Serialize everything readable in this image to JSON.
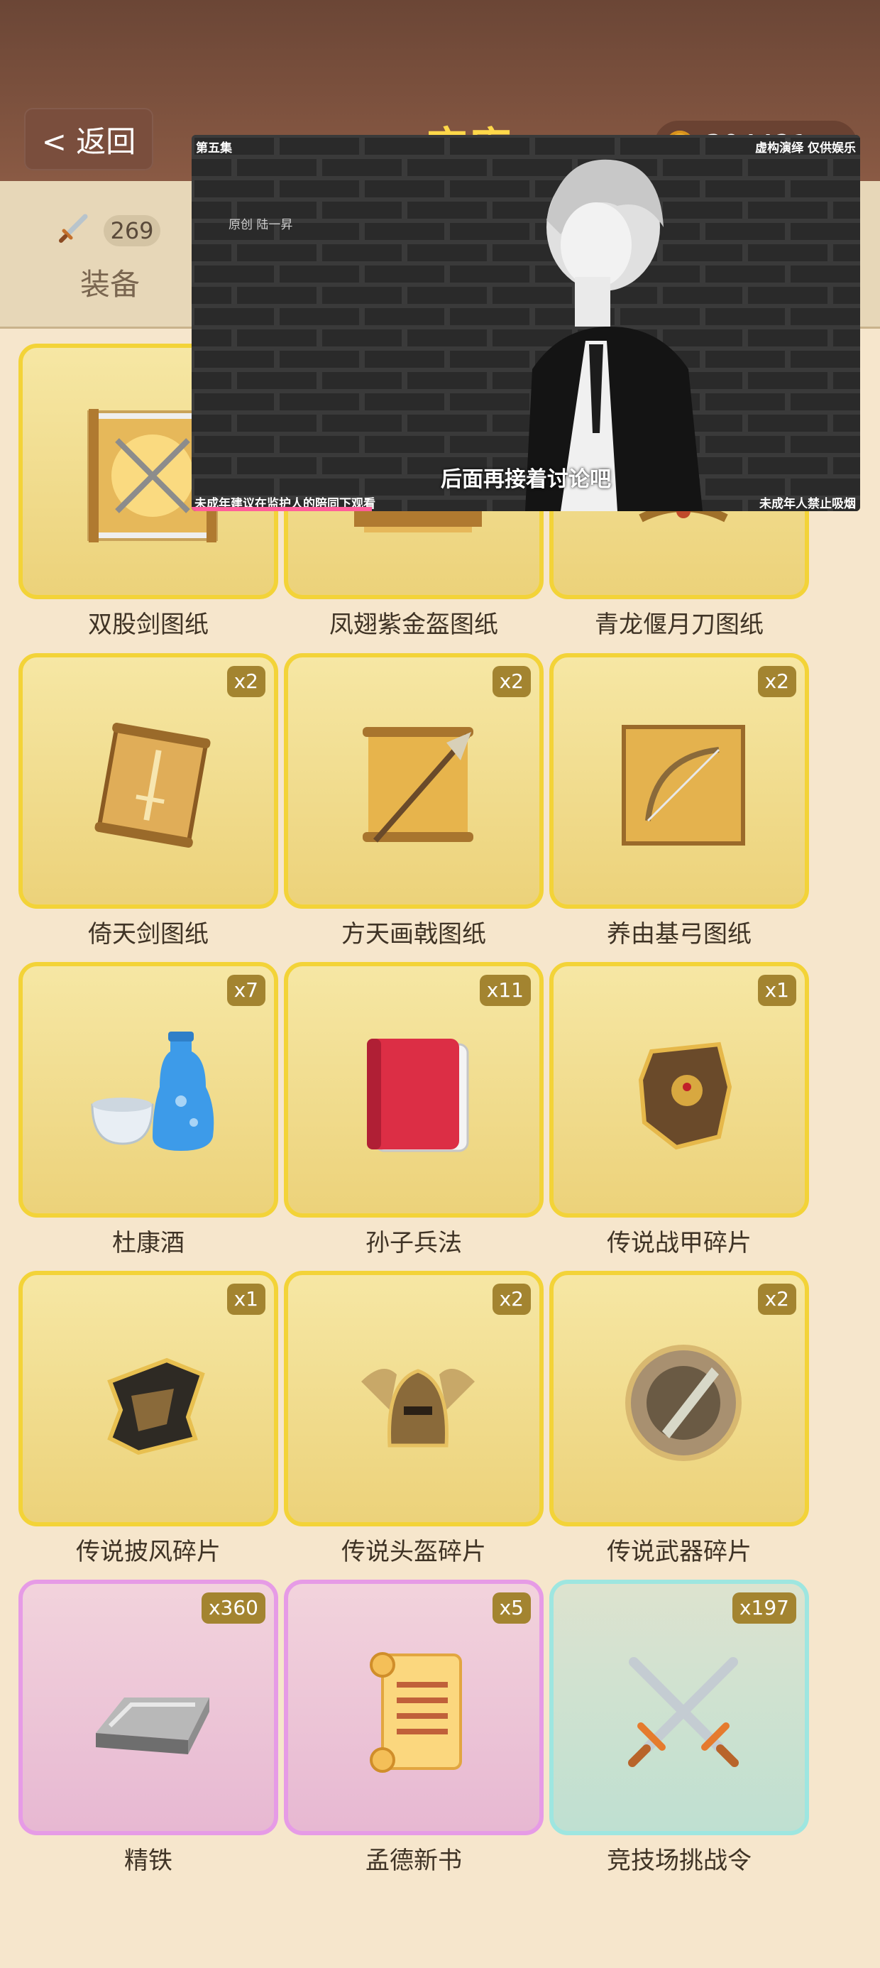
{
  "header": {
    "back_label": "< 返回",
    "title": "宝库",
    "coins": "304421"
  },
  "tabs": {
    "equip_count": "269",
    "equip_label": "装备"
  },
  "items": [
    {
      "name": "双股剑图纸",
      "count": "",
      "icon": "scroll-crossed-swords-icon"
    },
    {
      "name": "凤翅紫金盔图纸",
      "count": "",
      "icon": "scroll-helmet-icon"
    },
    {
      "name": "青龙偃月刀图纸",
      "count": "",
      "icon": "scroll-blade-icon"
    },
    {
      "name": "倚天剑图纸",
      "count": "x2",
      "icon": "scroll-sword-icon"
    },
    {
      "name": "方天画戟图纸",
      "count": "x2",
      "icon": "scroll-halberd-icon"
    },
    {
      "name": "养由基弓图纸",
      "count": "x2",
      "icon": "scroll-bow-icon"
    },
    {
      "name": "杜康酒",
      "count": "x7",
      "icon": "sake-bottle-icon"
    },
    {
      "name": "孙子兵法",
      "count": "x11",
      "icon": "red-book-icon"
    },
    {
      "name": "传说战甲碎片",
      "count": "x1",
      "icon": "armor-fragment-icon"
    },
    {
      "name": "传说披风碎片",
      "count": "x1",
      "icon": "cloak-fragment-icon"
    },
    {
      "name": "传说头盔碎片",
      "count": "x2",
      "icon": "helmet-fragment-icon"
    },
    {
      "name": "传说武器碎片",
      "count": "x2",
      "icon": "weapon-fragment-icon"
    },
    {
      "name": "精铁",
      "count": "x360",
      "icon": "iron-ingot-icon"
    },
    {
      "name": "孟德新书",
      "count": "x5",
      "icon": "paper-scroll-icon"
    },
    {
      "name": "竞技场挑战令",
      "count": "x197",
      "icon": "crossed-swords-icon"
    }
  ],
  "video": {
    "episode": "第五集",
    "disclaimer_top": "虚构演绎 仅供娱乐",
    "watermark": "原创 陆一昇",
    "subtitle": "后面再接着讨论吧",
    "notice_left": "未成年建议在监护人的陪同下观看",
    "notice_right": "未成年人禁止吸烟",
    "progress": 0.27
  }
}
